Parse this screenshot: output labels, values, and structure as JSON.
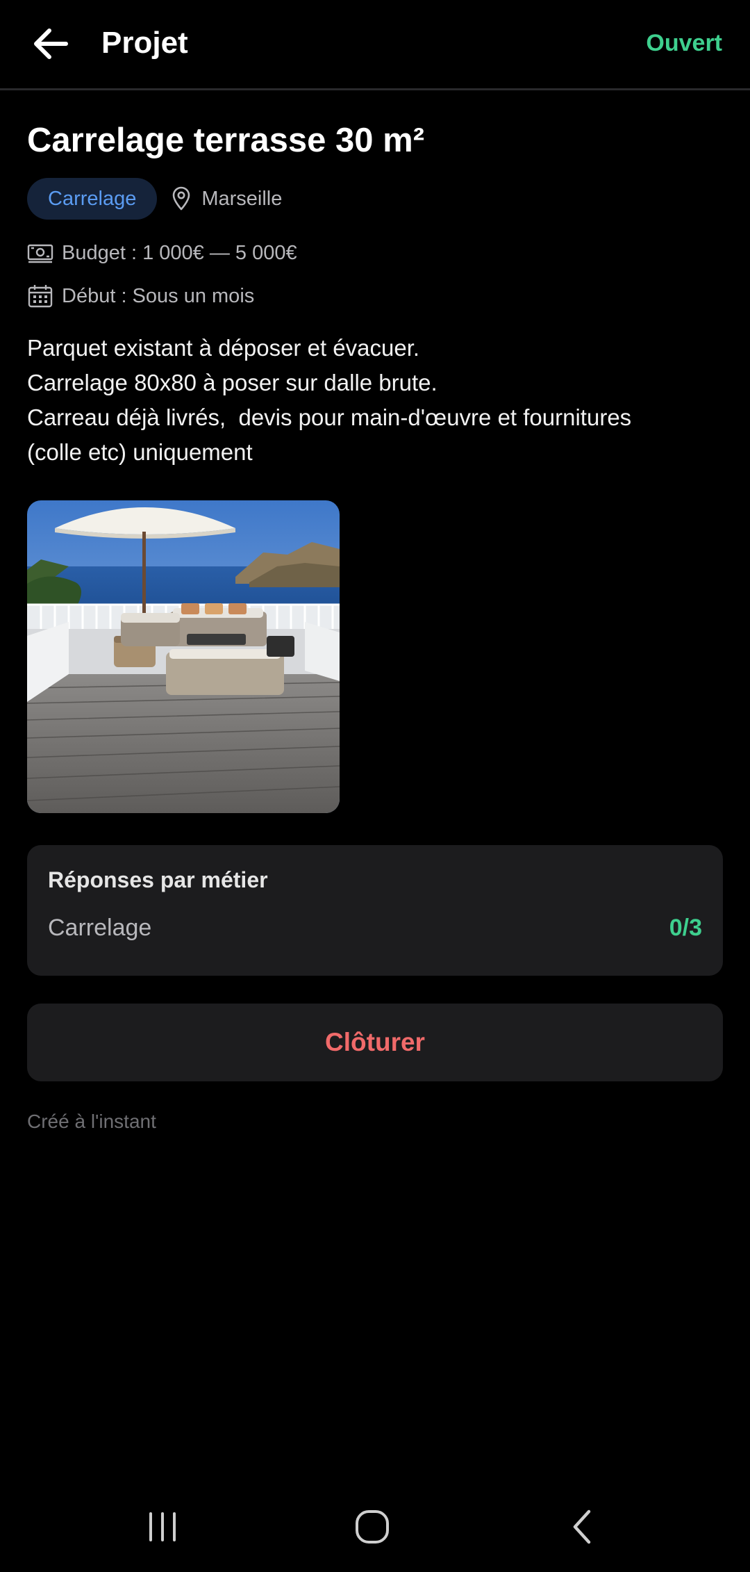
{
  "header": {
    "title": "Projet",
    "status": "Ouvert",
    "status_color": "#3ecf8e"
  },
  "project": {
    "title": "Carrelage terrasse 30 m²",
    "category": "Carrelage",
    "location": "Marseille",
    "budget": "Budget : 1 000€ — 5 000€",
    "start": "Début : Sous un mois",
    "description": [
      "Parquet existant à déposer et évacuer.",
      "Carrelage 80x80 à poser sur dalle brute.",
      "Carreau déjà livrés,  devis pour main-d'œuvre et fournitures",
      "(colle etc) uniquement"
    ]
  },
  "responses": {
    "title": "Réponses par métier",
    "rows": [
      {
        "label": "Carrelage",
        "count": "0/3"
      }
    ]
  },
  "actions": {
    "close_label": "Clôturer",
    "close_color": "#f06a6a"
  },
  "footer": {
    "created": "Créé à l'instant"
  },
  "icons": {
    "back": "arrow-left-icon",
    "location": "map-pin-icon",
    "budget": "banknote-icon",
    "calendar": "calendar-icon",
    "nav_recents": "recent-apps-icon",
    "nav_home": "home-icon",
    "nav_back": "chevron-left-icon"
  }
}
